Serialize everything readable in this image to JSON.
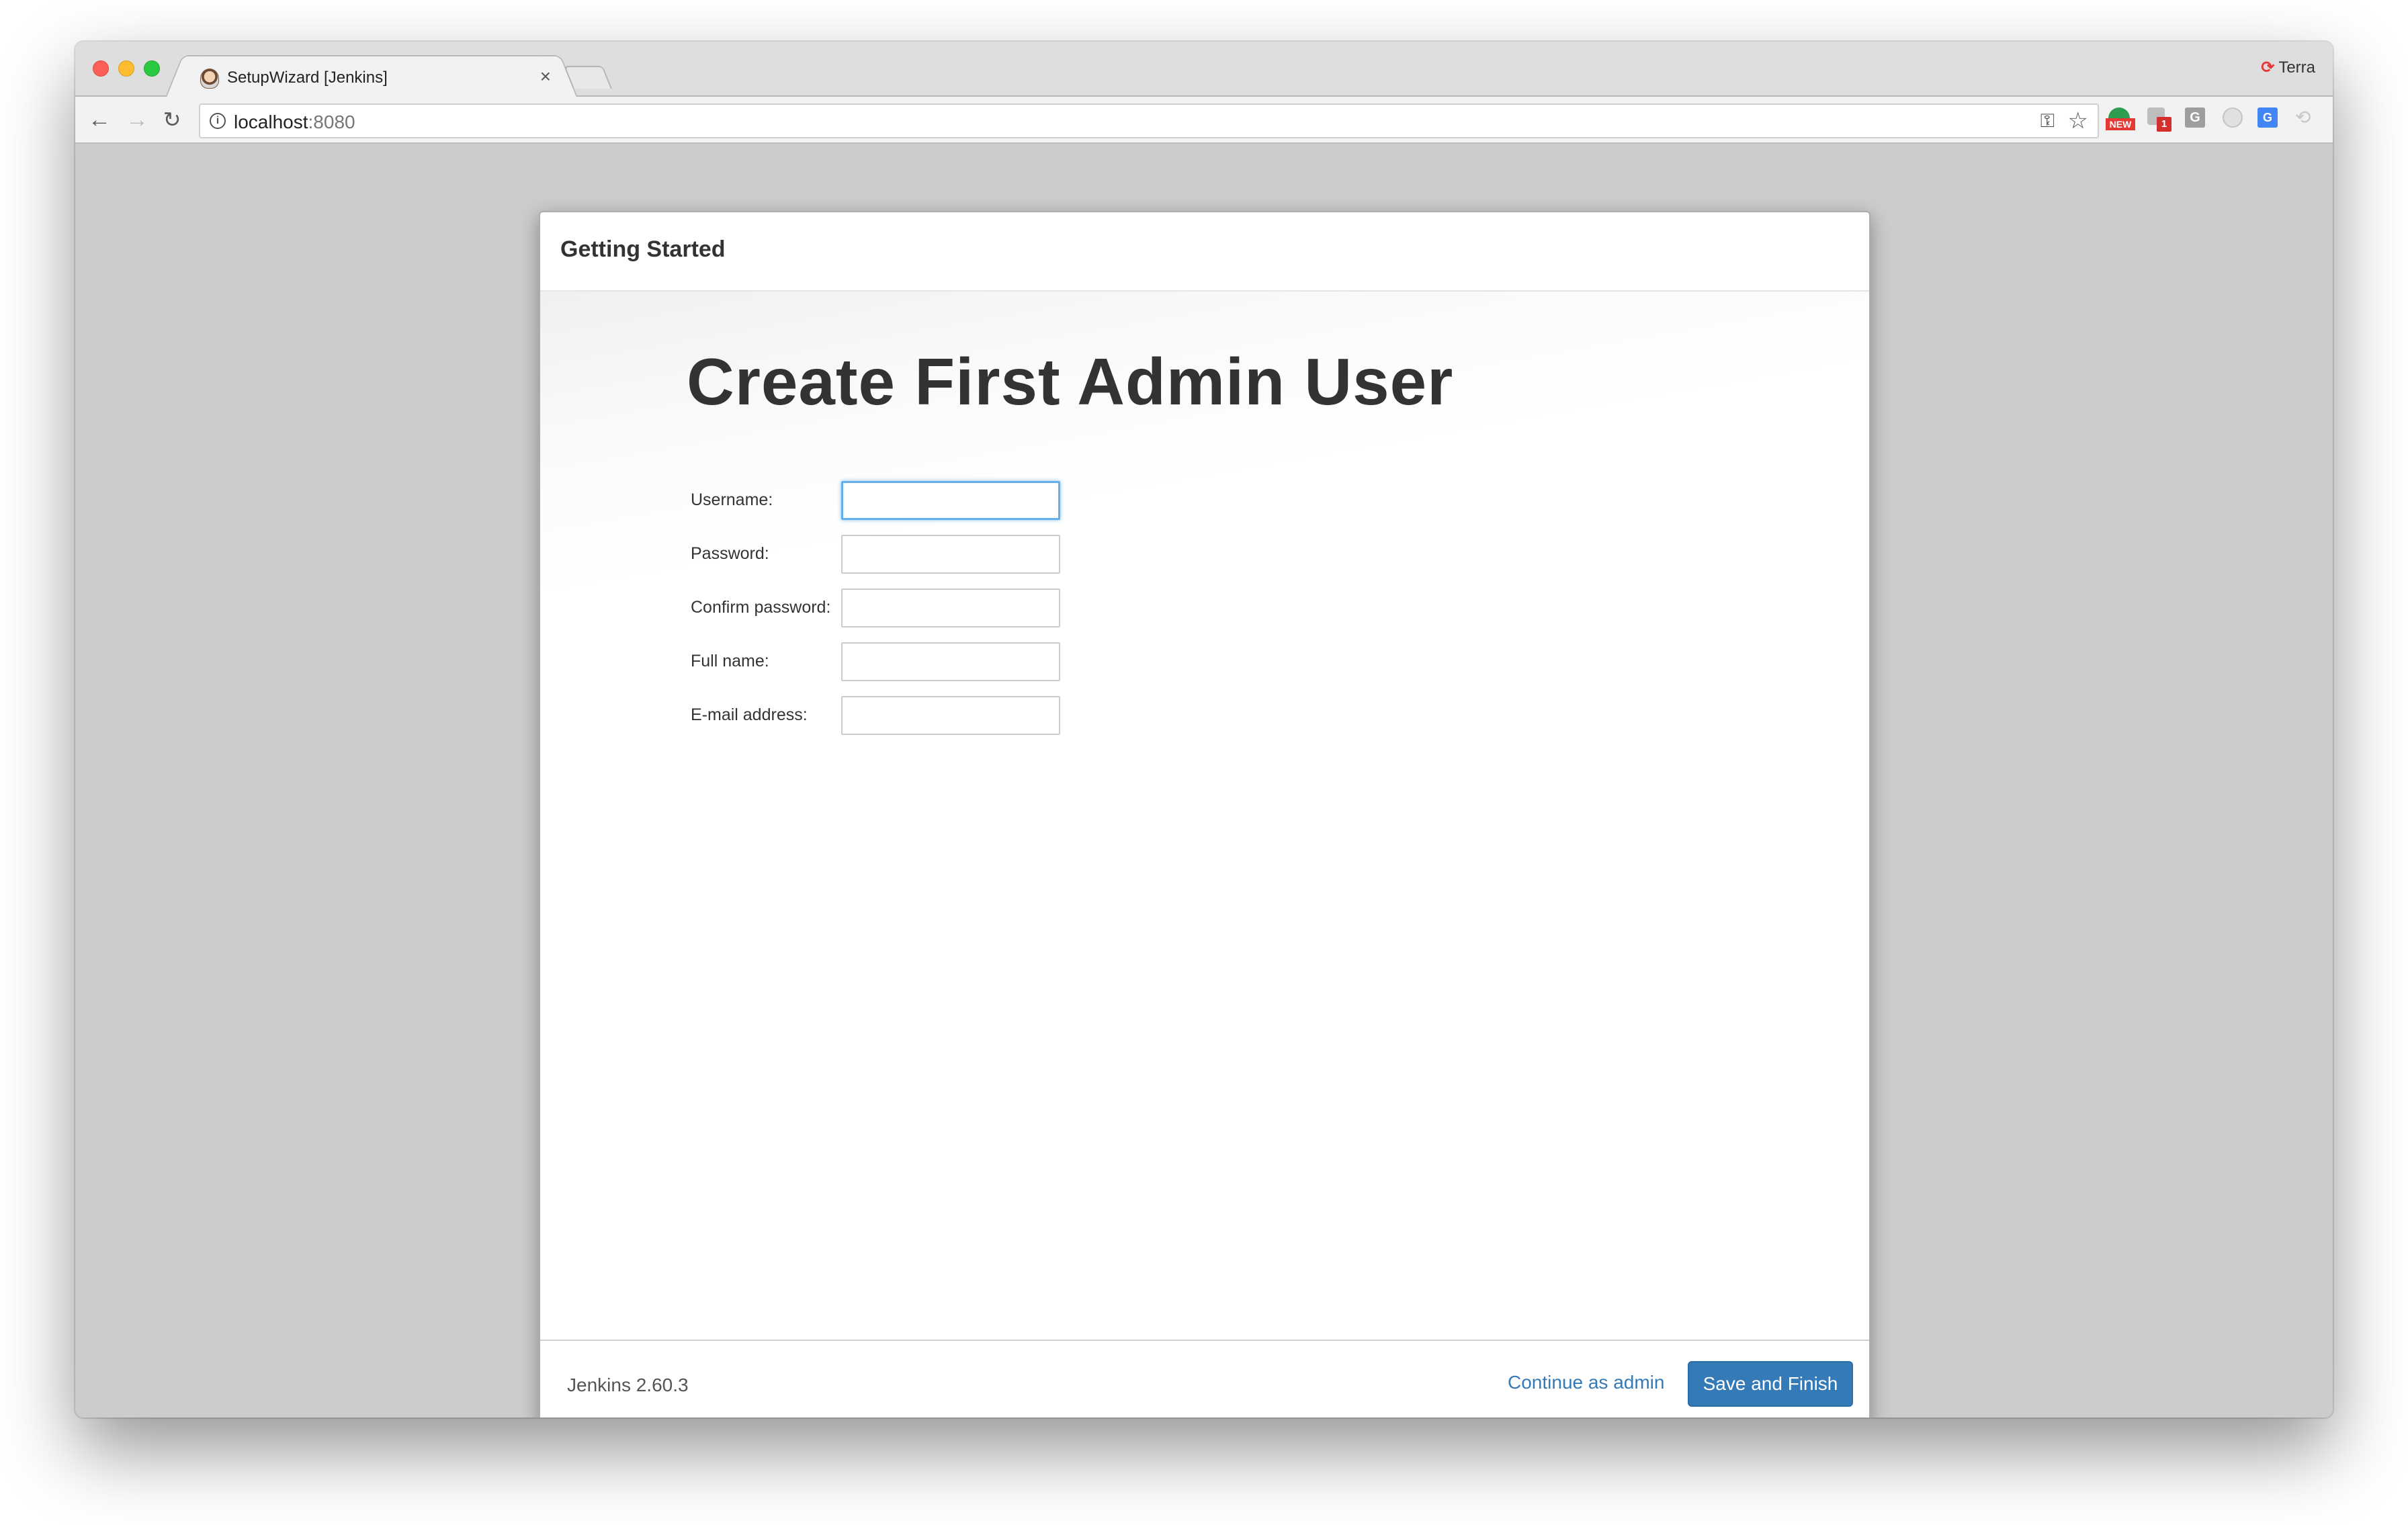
{
  "browser": {
    "tab_title": "SetupWizard [Jenkins]",
    "tab_close": "×",
    "profile_name": "Terra",
    "url_host": "localhost",
    "url_port": ":8080",
    "ext_badge_new": "NEW",
    "ext_badge_count": "1",
    "ext_g_label": "G",
    "icons": [
      "back-arrow-icon",
      "forward-arrow-icon",
      "reload-icon",
      "info-icon",
      "key-icon",
      "star-icon",
      "menu-icon"
    ]
  },
  "dialog": {
    "title": "Getting Started",
    "heading": "Create First Admin User",
    "fields": [
      {
        "label": "Username:",
        "value": "",
        "type": "text"
      },
      {
        "label": "Password:",
        "value": "",
        "type": "password"
      },
      {
        "label": "Confirm password:",
        "value": "",
        "type": "password"
      },
      {
        "label": "Full name:",
        "value": "",
        "type": "text"
      },
      {
        "label": "E-mail address:",
        "value": "",
        "type": "text"
      }
    ],
    "footer": {
      "version": "Jenkins 2.60.3",
      "continue_label": "Continue as admin",
      "save_label": "Save and Finish"
    }
  },
  "colors": {
    "primary": "#337ab7",
    "focus_ring": "#66afe9",
    "page_background": "#cccccc"
  }
}
